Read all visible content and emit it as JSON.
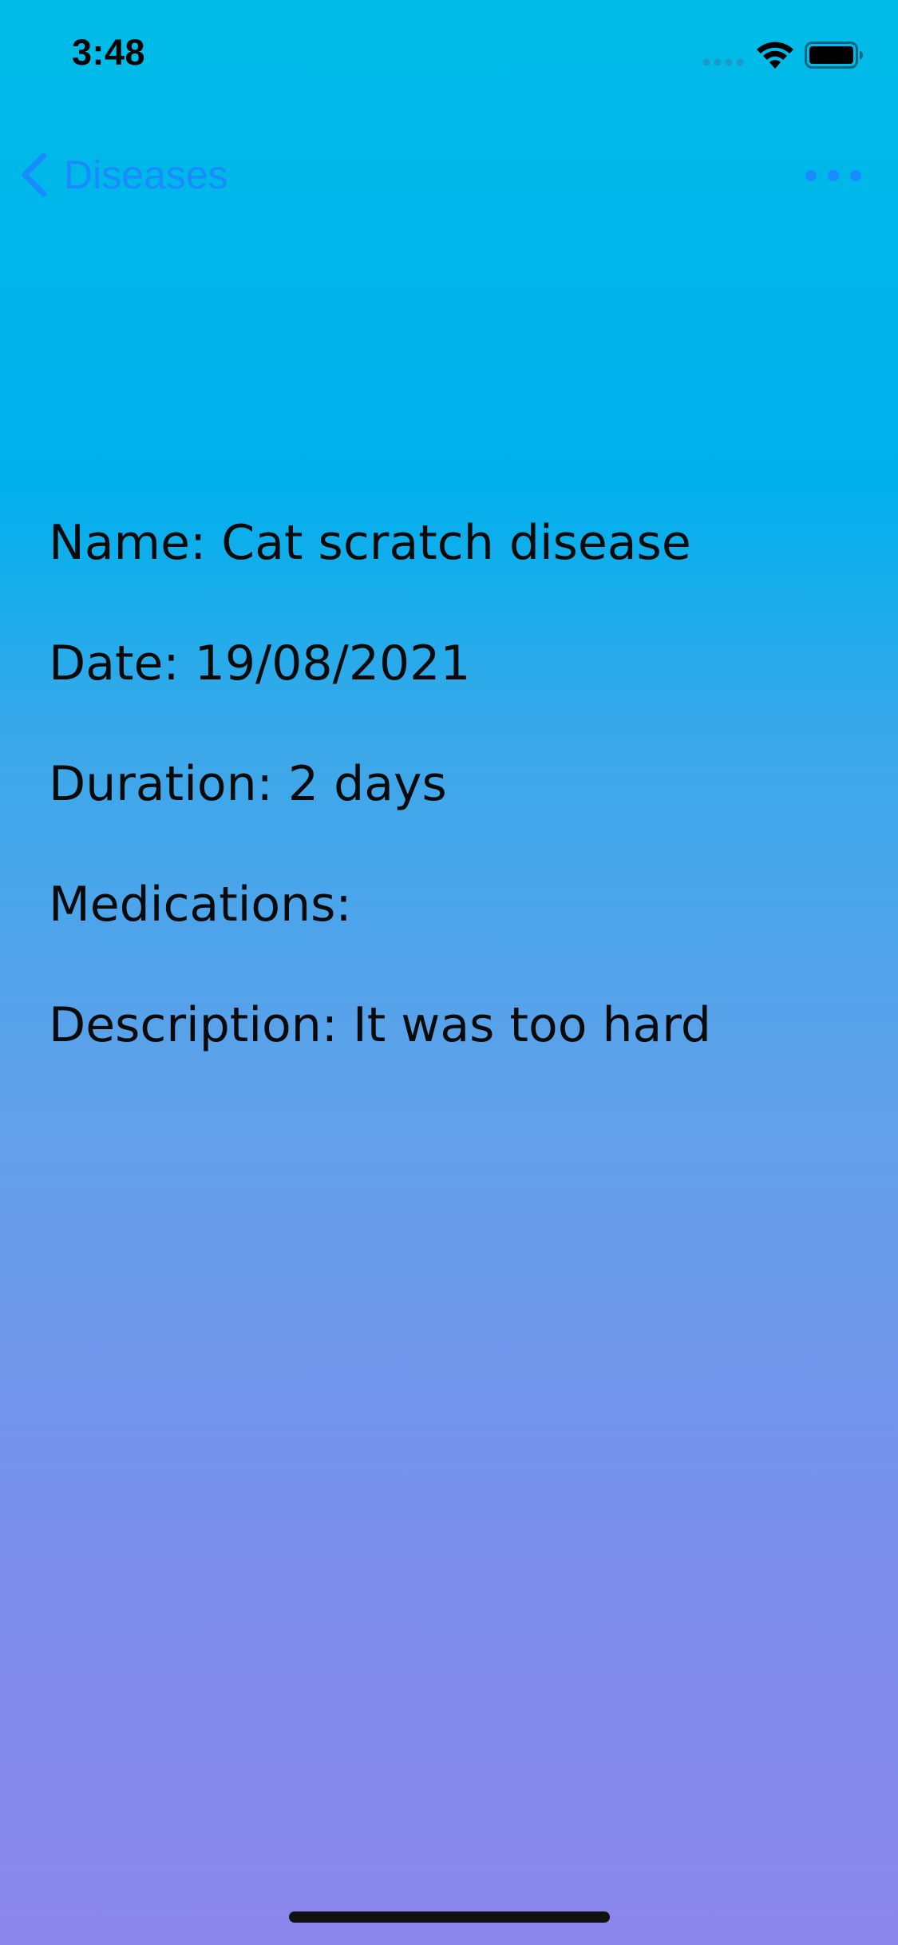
{
  "status_bar": {
    "time": "3:48",
    "icons": [
      "cellular-signal-icon",
      "wifi-icon",
      "battery-icon"
    ]
  },
  "nav": {
    "back_label": "Diseases",
    "back_icon": "chevron-left-icon",
    "more_icon": "ellipsis-icon",
    "accent_color": "#1A8BFF"
  },
  "details": {
    "name": "Name: Cat scratch disease",
    "date": "Date: 19/08/2021",
    "duration": "Duration: 2 days",
    "medications": "Medications:",
    "description": "Description: It was too hard"
  },
  "colors": {
    "background_top": "#00BBE8",
    "background_bottom": "#8C86EC",
    "text": "#0A0A0A"
  }
}
